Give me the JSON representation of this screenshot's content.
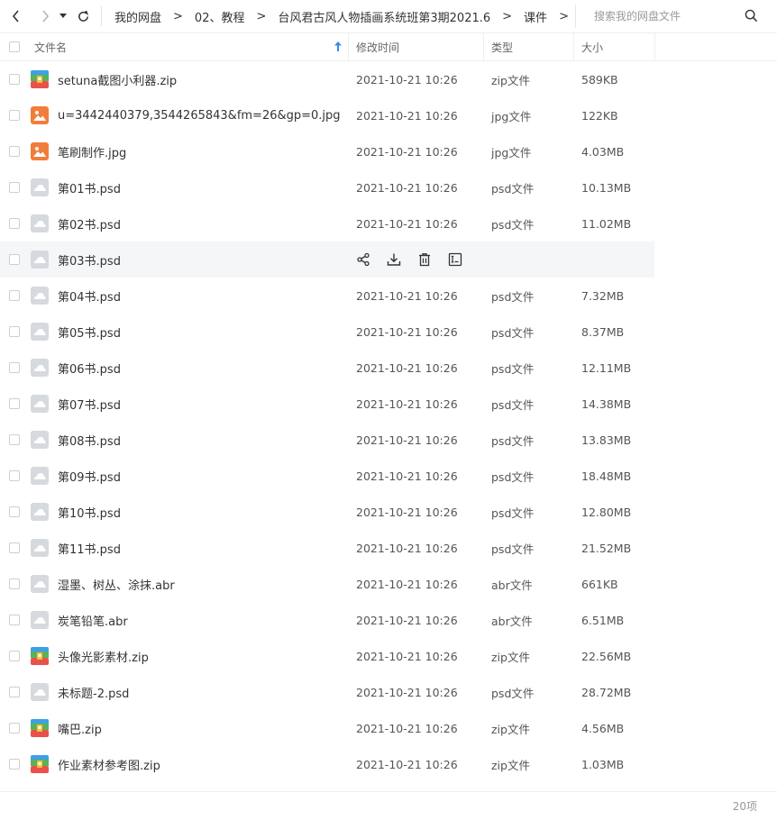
{
  "toolbar": {
    "back_icon": "chevron-left",
    "forward_icon": "chevron-right",
    "dropdown_icon": "caret-down",
    "refresh_icon": "refresh"
  },
  "breadcrumb": {
    "items": [
      "我的网盘",
      "02、教程",
      "台风君古风人物插画系统班第3期2021.6",
      "课件"
    ],
    "separator": ">"
  },
  "search": {
    "placeholder": "搜索我的网盘文件"
  },
  "columns": {
    "name": "文件名",
    "modified": "修改时间",
    "type": "类型",
    "size": "大小",
    "sort_icon": "arrow-up"
  },
  "files": [
    {
      "name": "setuna截图小利器.zip",
      "modified": "2021-10-21 10:26",
      "type": "zip文件",
      "size": "589KB",
      "icon": "zip"
    },
    {
      "name": "u=3442440379,3544265843&fm=26&gp=0.jpg",
      "modified": "2021-10-21 10:26",
      "type": "jpg文件",
      "size": "122KB",
      "icon": "image"
    },
    {
      "name": "笔刷制作.jpg",
      "modified": "2021-10-21 10:26",
      "type": "jpg文件",
      "size": "4.03MB",
      "icon": "image"
    },
    {
      "name": "第01书.psd",
      "modified": "2021-10-21 10:26",
      "type": "psd文件",
      "size": "10.13MB",
      "icon": "generic"
    },
    {
      "name": "第02书.psd",
      "modified": "2021-10-21 10:26",
      "type": "psd文件",
      "size": "11.02MB",
      "icon": "generic"
    },
    {
      "name": "第03书.psd",
      "modified": "",
      "type": "",
      "size": "",
      "icon": "generic",
      "hovered": true
    },
    {
      "name": "第04书.psd",
      "modified": "2021-10-21 10:26",
      "type": "psd文件",
      "size": "7.32MB",
      "icon": "generic"
    },
    {
      "name": "第05书.psd",
      "modified": "2021-10-21 10:26",
      "type": "psd文件",
      "size": "8.37MB",
      "icon": "generic"
    },
    {
      "name": "第06书.psd",
      "modified": "2021-10-21 10:26",
      "type": "psd文件",
      "size": "12.11MB",
      "icon": "generic"
    },
    {
      "name": "第07书.psd",
      "modified": "2021-10-21 10:26",
      "type": "psd文件",
      "size": "14.38MB",
      "icon": "generic"
    },
    {
      "name": "第08书.psd",
      "modified": "2021-10-21 10:26",
      "type": "psd文件",
      "size": "13.83MB",
      "icon": "generic"
    },
    {
      "name": "第09书.psd",
      "modified": "2021-10-21 10:26",
      "type": "psd文件",
      "size": "18.48MB",
      "icon": "generic"
    },
    {
      "name": "第10书.psd",
      "modified": "2021-10-21 10:26",
      "type": "psd文件",
      "size": "12.80MB",
      "icon": "generic"
    },
    {
      "name": "第11书.psd",
      "modified": "2021-10-21 10:26",
      "type": "psd文件",
      "size": "21.52MB",
      "icon": "generic"
    },
    {
      "name": "湿墨、树丛、涂抹.abr",
      "modified": "2021-10-21 10:26",
      "type": "abr文件",
      "size": "661KB",
      "icon": "generic"
    },
    {
      "name": "炭笔铅笔.abr",
      "modified": "2021-10-21 10:26",
      "type": "abr文件",
      "size": "6.51MB",
      "icon": "generic"
    },
    {
      "name": "头像光影素材.zip",
      "modified": "2021-10-21 10:26",
      "type": "zip文件",
      "size": "22.56MB",
      "icon": "zip"
    },
    {
      "name": "未标题-2.psd",
      "modified": "2021-10-21 10:26",
      "type": "psd文件",
      "size": "28.72MB",
      "icon": "generic"
    },
    {
      "name": "嘴巴.zip",
      "modified": "2021-10-21 10:26",
      "type": "zip文件",
      "size": "4.56MB",
      "icon": "zip"
    },
    {
      "name": "作业素材参考图.zip",
      "modified": "2021-10-21 10:26",
      "type": "zip文件",
      "size": "1.03MB",
      "icon": "zip"
    }
  ],
  "hover_actions": [
    "share-icon",
    "download-icon",
    "delete-icon",
    "rename-icon"
  ],
  "footer": {
    "count": "20项"
  },
  "colors": {
    "image_icon": "#f27d3a",
    "generic_icon": "#d6d9de",
    "zip_blue": "#3da0e8",
    "zip_green": "#59b25a",
    "zip_red": "#e8524a",
    "zip_yellow": "#f3c43a",
    "hover_bg": "#f5f6f8",
    "sort_arrow": "#3a8bea"
  }
}
